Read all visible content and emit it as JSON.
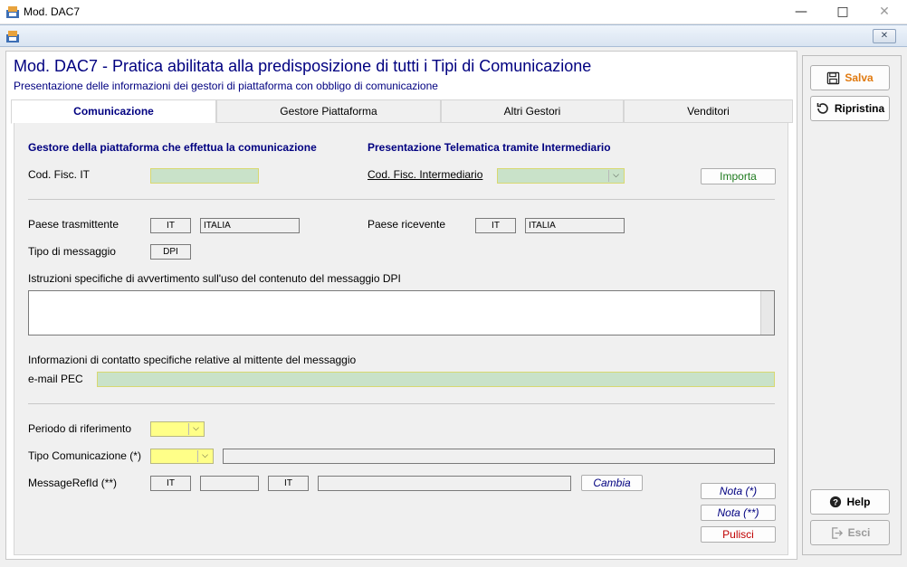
{
  "window": {
    "title": "Mod. DAC7",
    "minimize_glyph": "—",
    "maximize_glyph": "□",
    "close_glyph": "✕",
    "mdi_close_glyph": "✕"
  },
  "header": {
    "title": "Mod. DAC7 - Pratica abilitata alla predisposizione di tutti i Tipi di Comunicazione",
    "subtitle": "Presentazione delle informazioni dei gestori di piattaforma con obbligo di comunicazione"
  },
  "tabs": [
    {
      "label": "Comunicazione",
      "active": true
    },
    {
      "label": "Gestore Piattaforma",
      "active": false
    },
    {
      "label": "Altri Gestori",
      "active": false
    },
    {
      "label": "Venditori",
      "active": false
    }
  ],
  "form": {
    "gestore_section": "Gestore della piattaforma che effettua la comunicazione",
    "cod_fisc_label": "Cod. Fisc. IT",
    "cod_fisc_value": "",
    "intermediario_section": "Presentazione Telematica tramite Intermediario",
    "cod_fisc_intermediario_label": "Cod. Fisc. Intermediario",
    "cod_fisc_intermediario_value": "",
    "importa_label": "Importa",
    "paese_trasmittente_label": "Paese trasmittente",
    "paese_trasmittente_code": "IT",
    "paese_trasmittente_name": "ITALIA",
    "paese_ricevente_label": "Paese ricevente",
    "paese_ricevente_code": "IT",
    "paese_ricevente_name": "ITALIA",
    "tipo_messaggio_label": "Tipo di messaggio",
    "tipo_messaggio_value": "DPI",
    "istruzioni_label": "Istruzioni specifiche di avvertimento sull'uso del contenuto del messaggio DPI",
    "istruzioni_value": "",
    "contatto_label": "Informazioni di contatto specifiche relative al mittente del messaggio",
    "email_pec_label": "e-mail PEC",
    "email_pec_value": "",
    "periodo_label": "Periodo di riferimento",
    "periodo_value": "",
    "tipo_comunicazione_label": "Tipo Comunicazione (*)",
    "tipo_comunicazione_value": "",
    "tipo_comunicazione_desc": "",
    "message_ref_label": "MessageRefId (**)",
    "message_ref_country1": "IT",
    "message_ref_part2": "",
    "message_ref_country2": "IT",
    "message_ref_part4": "",
    "cambia_label": "Cambia",
    "nota1_label": "Nota (*)",
    "nota2_label": "Nota (**)",
    "pulisci_label": "Pulisci"
  },
  "sidebar": {
    "salva_label": "Salva",
    "ripristina_label": "Ripristina",
    "help_label": "Help",
    "esci_label": "Esci"
  },
  "colors": {
    "title_navy": "#000080",
    "salva_orange": "#e07a10",
    "pulisci_red": "#c00000",
    "importa_green": "#1e7a1e",
    "field_green": "#c9e2c9",
    "field_yellow": "#ffff88"
  },
  "icons": {
    "app": "app-icon",
    "save": "floppy-disk-icon",
    "restore": "refresh-icon",
    "help": "question-mark-icon",
    "exit": "exit-icon",
    "dropdown": "chevron-down-icon"
  }
}
